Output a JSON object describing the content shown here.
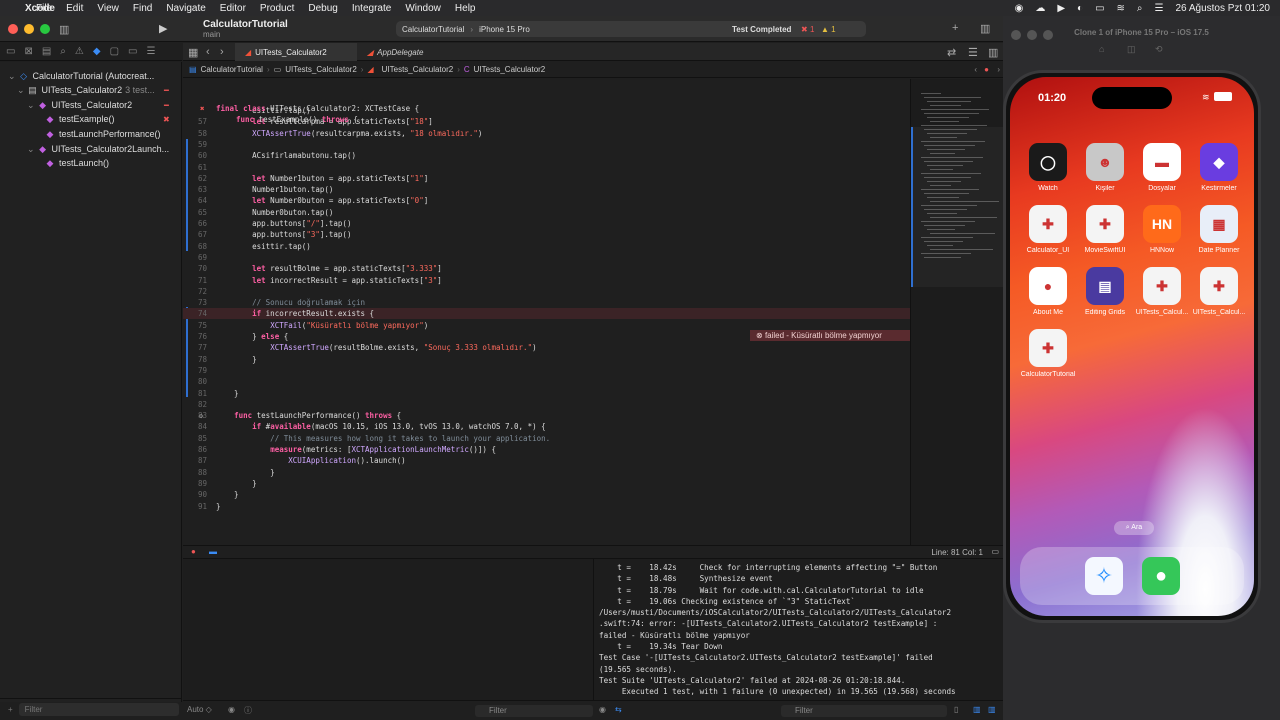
{
  "menubar": {
    "app_name": "Xcode",
    "items": [
      "File",
      "Edit",
      "View",
      "Find",
      "Navigate",
      "Editor",
      "Product",
      "Debug",
      "Integrate",
      "Window",
      "Help"
    ],
    "datetime": "26 Ağustos Pzt 01:20"
  },
  "toolbar": {
    "project_title": "CalculatorTutorial",
    "branch": "main",
    "scheme": "CalculatorTutorial",
    "destination": "iPhone 15 Pro",
    "status": "Test Completed",
    "error_count": "1",
    "warning_count": "1"
  },
  "navigator": {
    "items": [
      {
        "label": "CalculatorTutorial (Autocreat...",
        "level": 0
      },
      {
        "label": "UITests_Calculator2",
        "suffix": "3 test...",
        "level": 1
      },
      {
        "label": "UITests_Calculator2",
        "level": 2
      },
      {
        "label": "testExample()",
        "level": 3
      },
      {
        "label": "testLaunchPerformance()",
        "level": 3
      },
      {
        "label": "UITests_Calculator2Launch...",
        "level": 2
      },
      {
        "label": "testLaunch()",
        "level": 3
      }
    ],
    "filter_placeholder": "Filter"
  },
  "tabs": [
    {
      "label": "UITests_Calculator2",
      "active": true
    },
    {
      "label": "AppDelegate",
      "active": false
    }
  ],
  "jumpbar": [
    "CalculatorTutorial",
    "UITests_Calculator2",
    "UITests_Calculator2",
    "UITests_Calculator2"
  ],
  "editor": {
    "sticky_lines": [
      "final class UITests_Calculator2: XCTestCase {",
      "func testExample() throws {"
    ],
    "lines": [
      {
        "n": "",
        "t": "        esittir.tap()"
      },
      {
        "n": "57",
        "t": "        let resultcarpma = app.staticTexts[\"18\"]"
      },
      {
        "n": "58",
        "t": "        XCTAssertTrue(resultcarpma.exists, \"18 olmalıdır.\")"
      },
      {
        "n": "59",
        "t": ""
      },
      {
        "n": "60",
        "t": "        ACsifirlamabutonu.tap()"
      },
      {
        "n": "61",
        "t": ""
      },
      {
        "n": "62",
        "t": "        let Number1buton = app.staticTexts[\"1\"]"
      },
      {
        "n": "63",
        "t": "        Number1buton.tap()"
      },
      {
        "n": "64",
        "t": "        let Number0buton = app.staticTexts[\"0\"]"
      },
      {
        "n": "65",
        "t": "        Number0buton.tap()"
      },
      {
        "n": "66",
        "t": "        app.buttons[\"/\"].tap()"
      },
      {
        "n": "67",
        "t": "        app.buttons[\"3\"].tap()"
      },
      {
        "n": "68",
        "t": "        esittir.tap()"
      },
      {
        "n": "69",
        "t": ""
      },
      {
        "n": "70",
        "t": "        let resultBolme = app.staticTexts[\"3.333\"]"
      },
      {
        "n": "71",
        "t": "        let incorrectResult = app.staticTexts[\"3\"]"
      },
      {
        "n": "72",
        "t": ""
      },
      {
        "n": "73",
        "t": "        // Sonucu doğrulamak için"
      },
      {
        "n": "74",
        "t": "        if incorrectResult.exists {"
      },
      {
        "n": "75",
        "t": "            XCTFail(\"Küsüratlı bölme yapmıyor\")"
      },
      {
        "n": "76",
        "t": "        } else {"
      },
      {
        "n": "77",
        "t": "            XCTAssertTrue(resultBolme.exists, \"Sonuç 3.333 olmalıdır.\")"
      },
      {
        "n": "78",
        "t": "        }"
      },
      {
        "n": "79",
        "t": ""
      },
      {
        "n": "80",
        "t": ""
      },
      {
        "n": "81",
        "t": "    }"
      },
      {
        "n": "82",
        "t": ""
      },
      {
        "n": "83",
        "t": "    func testLaunchPerformance() throws {"
      },
      {
        "n": "84",
        "t": "        if #available(macOS 10.15, iOS 13.0, tvOS 13.0, watchOS 7.0, *) {"
      },
      {
        "n": "85",
        "t": "            // This measures how long it takes to launch your application."
      },
      {
        "n": "86",
        "t": "            measure(metrics: [XCTApplicationLaunchMetric()]) {"
      },
      {
        "n": "87",
        "t": "                XCUIApplication().launch()"
      },
      {
        "n": "88",
        "t": "            }"
      },
      {
        "n": "89",
        "t": "        }"
      },
      {
        "n": "90",
        "t": "    }"
      },
      {
        "n": "91",
        "t": "}"
      }
    ],
    "error_message": "failed - Küsüratlı bölme yapmıyor"
  },
  "statusbar": {
    "line_col": "Line: 81  Col: 1"
  },
  "console": {
    "lines": [
      "    t =    18.42s     Check for interrupting elements affecting \"=\" Button",
      "    t =    18.48s     Synthesize event",
      "    t =    18.79s     Wait for code.with.cal.CalculatorTutorial to idle",
      "    t =    19.06s Checking existence of `\"3\" StaticText`",
      "/Users/musti/Documents/iOSCalculator2/UITests_Calculator2/UITests_Calculator2",
      ".swift:74: error: -[UITests_Calculator2.UITests_Calculator2 testExample] :",
      "failed - Küsüratlı bölme yapmıyor",
      "    t =    19.34s Tear Down",
      "Test Case '-[UITests_Calculator2.UITests_Calculator2 testExample]' failed",
      "(19.565 seconds).",
      "Test Suite 'UITests_Calculator2' failed at 2024-08-26 01:20:18.844.",
      "     Executed 1 test, with 1 failure (0 unexpected) in 19.565 (19.568) seconds"
    ]
  },
  "debug_bottom": {
    "auto_label": "Auto ◇",
    "filter1": "Filter",
    "filter2": "Filter"
  },
  "simulator": {
    "title": "Clone 1 of iPhone 15 Pro – iOS 17.5",
    "time": "01:20",
    "search_label": "Ara",
    "apps": [
      {
        "label": "Watch",
        "color": "#1a1a1a",
        "glyph": "◯"
      },
      {
        "label": "Kişiler",
        "color": "#c8c8c8",
        "glyph": "☻"
      },
      {
        "label": "Dosyalar",
        "color": "#ffffff",
        "glyph": "▬"
      },
      {
        "label": "Kestirmeler",
        "color": "#6a3de0",
        "glyph": "◆"
      },
      {
        "label": "Calculator_UI",
        "color": "#f4f4f4",
        "glyph": "✚"
      },
      {
        "label": "MovieSwiftUI",
        "color": "#f4f4f4",
        "glyph": "✚"
      },
      {
        "label": "HNNow",
        "color": "#ff6a1a",
        "glyph": "HN"
      },
      {
        "label": "Date Planner",
        "color": "#e8eef8",
        "glyph": "▦"
      },
      {
        "label": "About Me",
        "color": "#ffffff",
        "glyph": "●"
      },
      {
        "label": "Editing Grids",
        "color": "#4a3aa0",
        "glyph": "▤"
      },
      {
        "label": "UITests_Calcul...",
        "color": "#f4f4f4",
        "glyph": "✚"
      },
      {
        "label": "UITests_Calcul...",
        "color": "#f4f4f4",
        "glyph": "✚"
      },
      {
        "label": "CalculatorTutorial",
        "color": "#f4f4f4",
        "glyph": "✚"
      }
    ]
  }
}
